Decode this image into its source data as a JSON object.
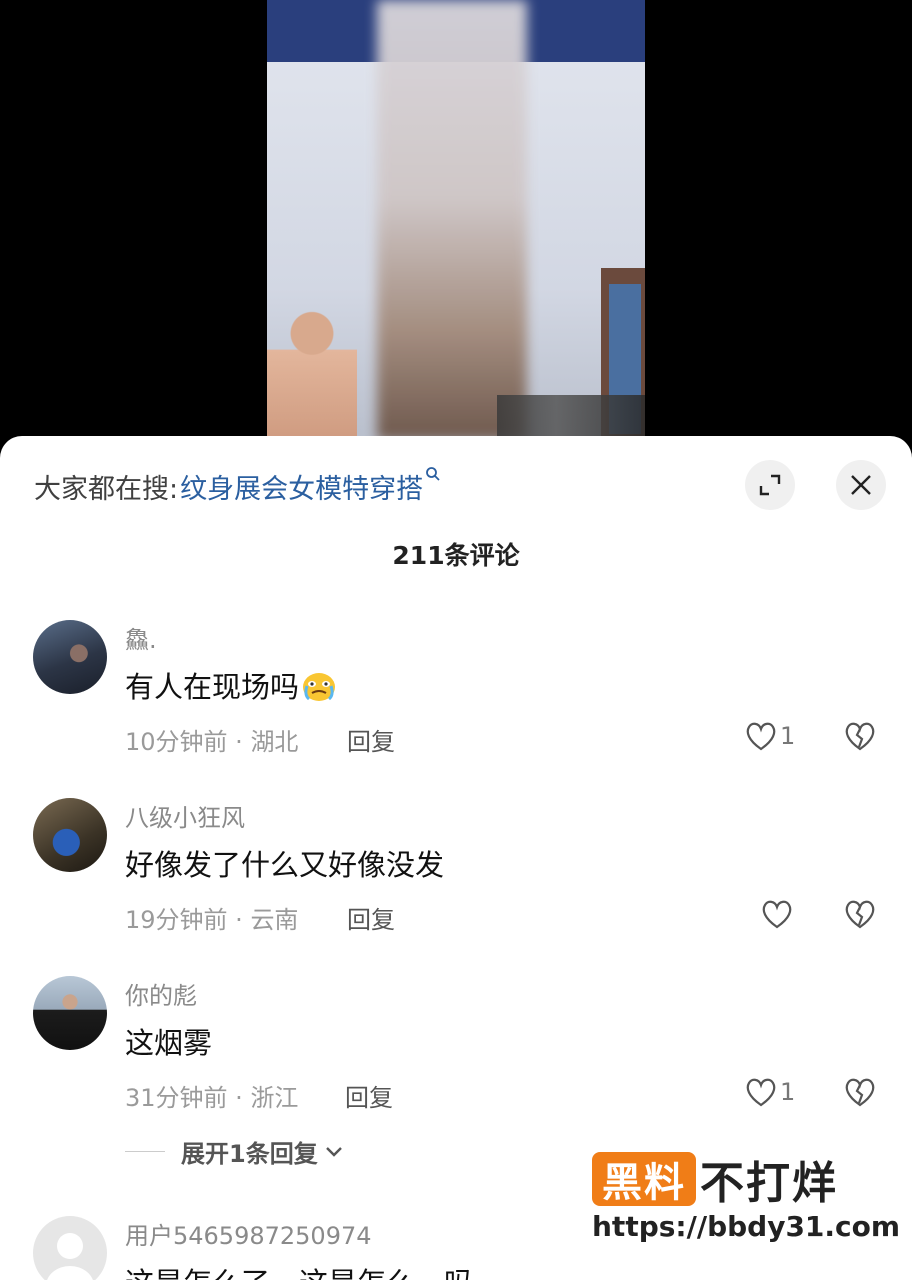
{
  "search": {
    "prefix": "大家都在搜:",
    "term": "纹身展会女模特穿搭"
  },
  "comments_header": {
    "count_label": "211条评论"
  },
  "comments": [
    {
      "username": "鱻.",
      "text": "有人在现场吗",
      "time": "10分钟前",
      "location": "湖北",
      "reply_label": "回复",
      "likes": "1"
    },
    {
      "username": "八级小狂风",
      "text": "好像发了什么又好像没发",
      "time": "19分钟前",
      "location": "云南",
      "reply_label": "回复",
      "likes": ""
    },
    {
      "username": "你的彪",
      "text": "这烟雾",
      "time": "31分钟前",
      "location": "浙江",
      "reply_label": "回复",
      "likes": "1"
    },
    {
      "username": "用户5465987250974",
      "text": "这是怎么了，这是怎么，吗"
    }
  ],
  "expand_replies": {
    "label": "展开1条回复"
  },
  "watermark": {
    "badge": "黑料",
    "text": "不打烊",
    "url": "https://bbdy31.com"
  },
  "colors": {
    "accent_link": "#2b5fa0",
    "watermark_orange": "#f07d17"
  }
}
